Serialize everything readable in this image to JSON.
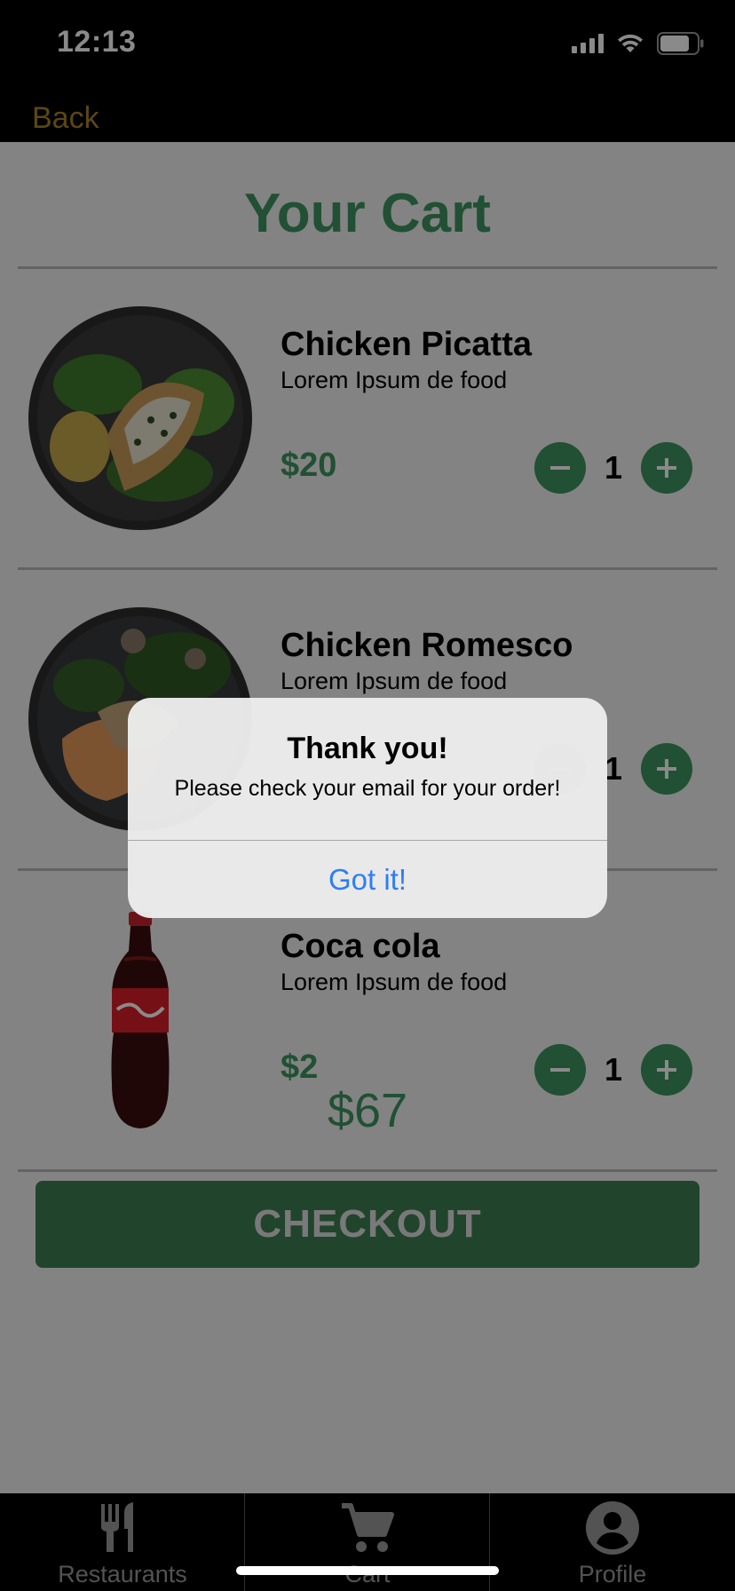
{
  "status_bar": {
    "time": "12:13"
  },
  "nav": {
    "back_label": "Back"
  },
  "cart": {
    "title": "Your Cart",
    "items": [
      {
        "name": "Chicken Picatta",
        "description": "Lorem Ipsum de food",
        "price": "$20",
        "quantity": "1",
        "image": "chicken-picatta-bowl"
      },
      {
        "name": "Chicken Romesco",
        "description": "Lorem Ipsum de food",
        "price": "",
        "quantity": "1",
        "image": "chicken-romesco-bowl"
      },
      {
        "name": "Coca cola",
        "description": "Lorem Ipsum de food",
        "price": "$2",
        "quantity": "1",
        "image": "coca-cola-bottle"
      }
    ],
    "total": "$67",
    "checkout_label": "CHECKOUT"
  },
  "alert": {
    "title": "Thank you!",
    "message": "Please check your email for your order!",
    "button_label": "Got it!"
  },
  "tab_bar": {
    "tabs": [
      {
        "label": "Restaurants",
        "icon": "fork-knife-icon"
      },
      {
        "label": "Cart",
        "icon": "cart-icon"
      },
      {
        "label": "Profile",
        "icon": "profile-icon"
      }
    ]
  },
  "colors": {
    "accent_green": "#3d9460",
    "checkout_green": "#3d7f54",
    "back_gold": "#a88427",
    "alert_button_blue": "#2f7df6"
  }
}
